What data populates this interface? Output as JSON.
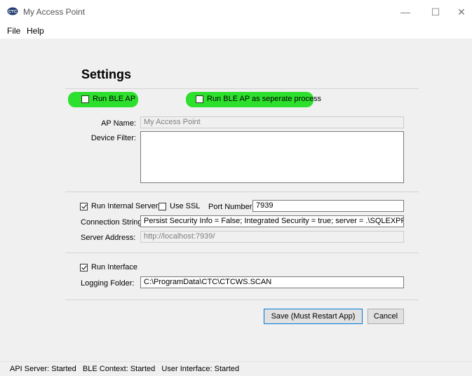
{
  "window": {
    "title": "My Access Point",
    "minimize_glyph": "—",
    "maximize_glyph": "☐",
    "close_glyph": "✕"
  },
  "menu": {
    "items": [
      "File",
      "Help"
    ]
  },
  "settings": {
    "heading": "Settings",
    "run_ble_ap": {
      "label": "Run BLE AP",
      "checked": false
    },
    "run_ble_separate": {
      "label": "Run BLE AP as seperate process",
      "checked": false
    },
    "ap_name": {
      "label": "AP Name:",
      "value": "My Access Point"
    },
    "device_filter": {
      "label": "Device Filter:",
      "value": ""
    },
    "run_internal_server": {
      "label": "Run Internal Server",
      "checked": true
    },
    "use_ssl": {
      "label": "Use SSL",
      "checked": false
    },
    "port_number": {
      "label": "Port Number:",
      "value": "7939"
    },
    "connection_string": {
      "label": "Connection String:",
      "value": "Persist Security Info = False; Integrated Security = true; server = .\\SQLEXPRESS;"
    },
    "server_address": {
      "label": "Server Address:",
      "value": "http://localhost:7939/"
    },
    "run_interface": {
      "label": "Run Interface",
      "checked": true
    },
    "logging_folder": {
      "label": "Logging Folder:",
      "value": "C:\\ProgramData\\CTC\\CTCWS.SCAN"
    },
    "save_label": "Save (Must Restart App)",
    "cancel_label": "Cancel"
  },
  "status_bar": {
    "text": "API Server: Started   BLE Context: Started   User Interface: Started"
  },
  "colors": {
    "highlight": "#2de02d",
    "accent": "#0078d7",
    "window_bg": "#f0f0f0"
  }
}
